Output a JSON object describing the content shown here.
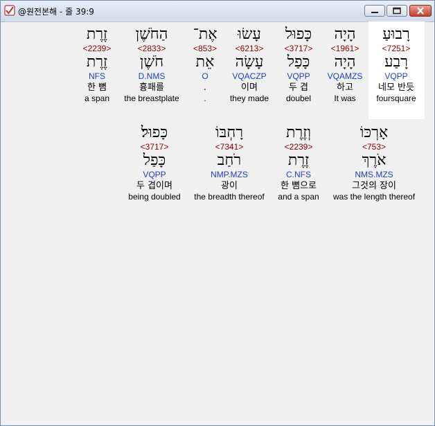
{
  "window": {
    "title": "@원전본해 - 줄 39:9",
    "icon": "app-check-icon"
  },
  "colors": {
    "strong": "#8b0000",
    "parse": "#1f3fbf",
    "highlight": "#ffffff"
  },
  "rows": [
    [
      {
        "heb": "רָבוּעַ",
        "strong": "<7251>",
        "lemma": "רָבַע",
        "parse": "VQPP",
        "kor": "네모 반듯",
        "eng": "foursquare"
      },
      {
        "heb": "הָיָה",
        "strong": "<1961>",
        "lemma": "הָיָה",
        "parse": "VQAMZS",
        "kor": "하고",
        "eng": "It was"
      },
      {
        "heb": "כָּפוּל",
        "strong": "<3717>",
        "lemma": "כָּפַל",
        "parse": "VQPP",
        "kor": "두 겹",
        "eng": "doubel"
      },
      {
        "heb": "עָשׂוּ",
        "strong": "<6213>",
        "lemma": "עָשָׂה",
        "parse": "VQACZP",
        "kor": "이며",
        "eng": "they made"
      },
      {
        "heb": "אֶת־",
        "strong": "<853>",
        "lemma": "אֵת",
        "parse": "O",
        "kor": ".",
        "eng": "."
      },
      {
        "heb": "הַחֹשֶׁן",
        "strong": "<2833>",
        "lemma": "חֹשֶׁן",
        "parse": "D.NMS",
        "kor": "흉패를",
        "eng": "the breastplate"
      },
      {
        "heb": "זֶרֶת",
        "strong": "<2239>",
        "lemma": "זֶרֶת",
        "parse": "NFS",
        "kor": "한 뼘",
        "eng": "a span"
      }
    ],
    [
      {
        "heb": "אָרְכּוֹ",
        "strong": "<753>",
        "lemma": "אֹרֶךְ",
        "parse": "NMS.MZS",
        "kor": "그것의 장이",
        "eng": "was the length thereof"
      },
      {
        "heb": "וְזֶרֶת",
        "strong": "<2239>",
        "lemma": "זֶרֶת",
        "parse": "C.NFS",
        "kor": "한 뼘으로",
        "eng": "and a span"
      },
      {
        "heb": "רָחְבּוֹ",
        "strong": "<7341>",
        "lemma": "רֹחַב",
        "parse": "NMP.MZS",
        "kor": "광이",
        "eng": "the breadth thereof"
      },
      {
        "heb": "כָּפוּל׃",
        "strong": "<3717>",
        "lemma": "כָּפַל",
        "parse": "VQPP",
        "kor": "두 겹이며",
        "eng": "being doubled"
      }
    ]
  ]
}
